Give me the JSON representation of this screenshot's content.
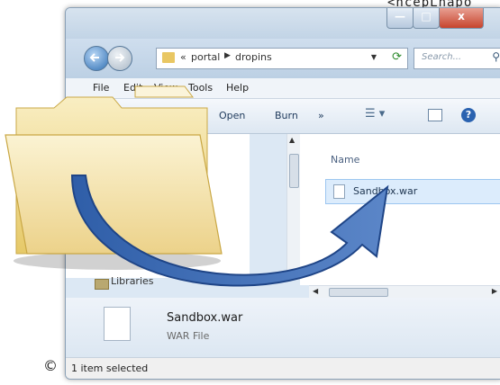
{
  "corner_text": "<ncepLnapo",
  "window": {
    "controls": {
      "minimize": "—",
      "maximize": "□",
      "close": "x"
    },
    "address": {
      "crumbs": [
        "«",
        "portal",
        "dropins"
      ],
      "separator": "▶"
    },
    "search": {
      "placeholder": "Search...",
      "icon": "search-icon"
    }
  },
  "menubar": {
    "items": [
      "File",
      "Edit",
      "View",
      "Tools",
      "Help"
    ]
  },
  "toolbar": {
    "items": [
      "Open",
      "Burn",
      "»"
    ]
  },
  "navpane": {
    "partial_label": "s",
    "libraries_label": "Libraries"
  },
  "content": {
    "column_header": "Name",
    "file": "Sandbox.war"
  },
  "details": {
    "name": "Sandbox.war",
    "type": "WAR File"
  },
  "statusbar": {
    "text": "1 item selected"
  },
  "copyright": "©",
  "colors": {
    "accent": "#3f6ab0",
    "folder": "#f2dc93",
    "selection": "#dcecfc"
  }
}
